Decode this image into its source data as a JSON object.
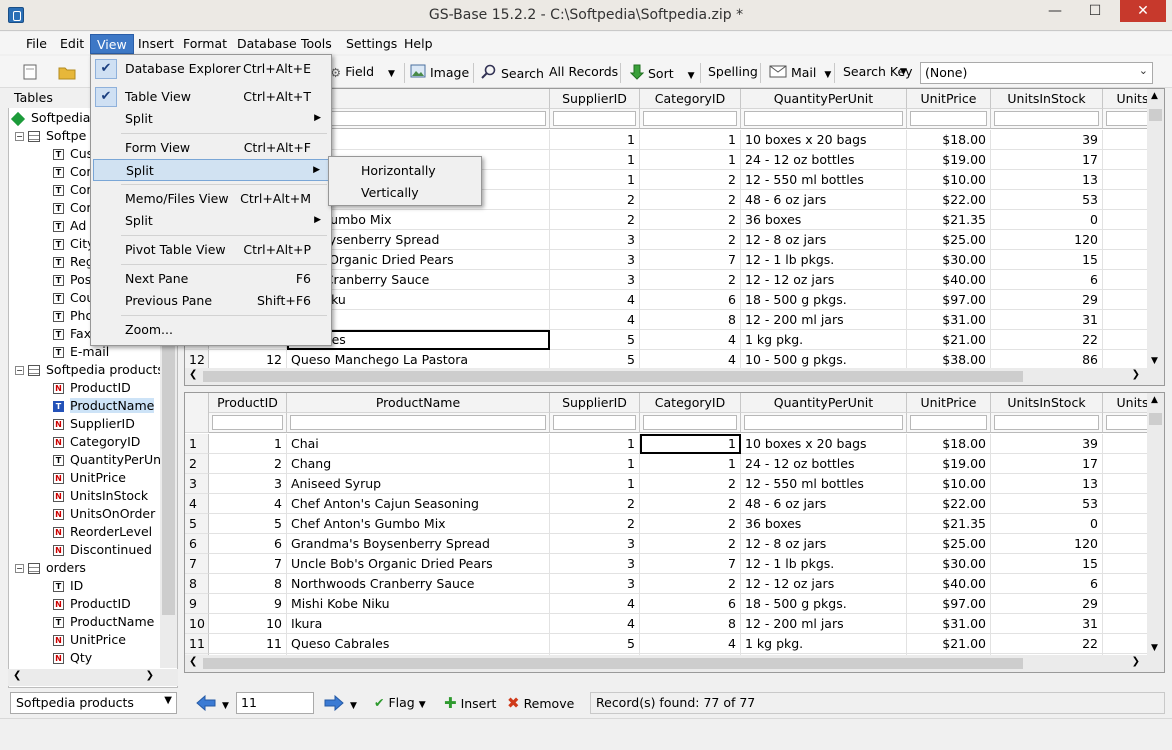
{
  "window": {
    "title": "GS-Base 15.2.2 - C:\\Softpedia\\Softpedia.zip *",
    "minimize": "—",
    "maximize": "☐",
    "close": "✕"
  },
  "menubar": [
    "File",
    "Edit",
    "View",
    "Insert",
    "Format",
    "Database",
    "Tools",
    "Settings",
    "Help"
  ],
  "toolbar": {
    "field": "Field",
    "image": "Image",
    "search": "Search",
    "all_records": "All Records",
    "sort": "Sort",
    "spelling": "Spelling",
    "mail": "Mail",
    "search_key": "Search Key",
    "search_key_value": "(None)"
  },
  "tables_panel": {
    "header": "Tables",
    "tree": [
      {
        "label": "Softpedia",
        "type": "db"
      },
      {
        "label": "Softpe",
        "type": "table"
      },
      {
        "label": "Cus",
        "type": "T"
      },
      {
        "label": "Cor",
        "type": "T"
      },
      {
        "label": "Cor",
        "type": "T"
      },
      {
        "label": "Cor",
        "type": "T"
      },
      {
        "label": "Ad",
        "type": "T"
      },
      {
        "label": "City",
        "type": "T"
      },
      {
        "label": "Reg",
        "type": "T"
      },
      {
        "label": "Pos",
        "type": "T"
      },
      {
        "label": "Cou",
        "type": "T"
      },
      {
        "label": "Pho",
        "type": "T"
      },
      {
        "label": "Fax",
        "type": "T"
      },
      {
        "label": "E-mail",
        "type": "T"
      },
      {
        "label": "Softpedia products",
        "type": "table"
      },
      {
        "label": "ProductID",
        "type": "N"
      },
      {
        "label": "ProductName",
        "type": "T",
        "selected": true
      },
      {
        "label": "SupplierID",
        "type": "N"
      },
      {
        "label": "CategoryID",
        "type": "N"
      },
      {
        "label": "QuantityPerUnit",
        "type": "T"
      },
      {
        "label": "UnitPrice",
        "type": "N"
      },
      {
        "label": "UnitsInStock",
        "type": "N"
      },
      {
        "label": "UnitsOnOrder",
        "type": "N"
      },
      {
        "label": "ReorderLevel",
        "type": "N"
      },
      {
        "label": "Discontinued",
        "type": "N"
      },
      {
        "label": "orders",
        "type": "table"
      },
      {
        "label": "ID",
        "type": "T"
      },
      {
        "label": "ProductID",
        "type": "N"
      },
      {
        "label": "ProductName",
        "type": "T"
      },
      {
        "label": "UnitPrice",
        "type": "N"
      },
      {
        "label": "Qty",
        "type": "N"
      }
    ]
  },
  "view_menu": {
    "items": [
      {
        "label": "Database Explorer",
        "shortcut": "Ctrl+Alt+E",
        "checked": true
      },
      {
        "label": "Table View",
        "shortcut": "Ctrl+Alt+T",
        "checked": true
      },
      {
        "label": "Split",
        "shortcut": "",
        "submenu": true
      },
      {
        "label": "Form View",
        "shortcut": "Ctrl+Alt+F"
      },
      {
        "label": "Split",
        "shortcut": "",
        "submenu": true,
        "highlighted": true
      },
      {
        "label": "Memo/Files View",
        "shortcut": "Ctrl+Alt+M"
      },
      {
        "label": "Split",
        "shortcut": "",
        "submenu": true
      },
      {
        "label": "Pivot Table View",
        "shortcut": "Ctrl+Alt+P"
      },
      {
        "label": "Next Pane",
        "shortcut": "F6"
      },
      {
        "label": "Previous Pane",
        "shortcut": "Shift+F6"
      },
      {
        "label": "Zoom...",
        "shortcut": ""
      }
    ],
    "submenu": [
      "Horizontally",
      "Vertically"
    ]
  },
  "grid": {
    "columns": [
      "ProductID",
      "ProductName",
      "SupplierID",
      "CategoryID",
      "QuantityPerUnit",
      "UnitPrice",
      "UnitsInStock",
      "Units"
    ],
    "rows": [
      [
        "1",
        "1",
        "Chai",
        "1",
        "1",
        "10 boxes x 20 bags",
        "$18.00",
        "39"
      ],
      [
        "2",
        "2",
        "Chang",
        "1",
        "1",
        "24 - 12 oz bottles",
        "$19.00",
        "17"
      ],
      [
        "3",
        "3",
        "Aniseed Syrup",
        "1",
        "2",
        "12 - 550 ml bottles",
        "$10.00",
        "13"
      ],
      [
        "4",
        "4",
        "Chef Anton's Cajun Seasoning",
        "2",
        "2",
        "48 - 6 oz jars",
        "$22.00",
        "53"
      ],
      [
        "5",
        "5",
        "Chef Anton's Gumbo Mix",
        "2",
        "2",
        "36 boxes",
        "$21.35",
        "0"
      ],
      [
        "6",
        "6",
        "Grandma's Boysenberry Spread",
        "3",
        "2",
        "12 - 8 oz jars",
        "$25.00",
        "120"
      ],
      [
        "7",
        "7",
        "Uncle Bob's Organic Dried Pears",
        "3",
        "7",
        "12 - 1 lb pkgs.",
        "$30.00",
        "15"
      ],
      [
        "8",
        "8",
        "Northwoods Cranberry Sauce",
        "3",
        "2",
        "12 - 12 oz jars",
        "$40.00",
        "6"
      ],
      [
        "9",
        "9",
        "Mishi Kobe Niku",
        "4",
        "6",
        "18 - 500 g pkgs.",
        "$97.00",
        "29"
      ],
      [
        "10",
        "10",
        "Ikura",
        "4",
        "8",
        "12 - 200 ml jars",
        "$31.00",
        "31"
      ],
      [
        "11",
        "11",
        "Queso Cabrales",
        "5",
        "4",
        "1 kg pkg.",
        "$21.00",
        "22"
      ],
      [
        "12",
        "12",
        "Queso Manchego La Pastora",
        "5",
        "4",
        "10 - 500 g pkgs.",
        "$38.00",
        "86"
      ]
    ],
    "top_pane_visible_text": [
      "",
      "",
      "",
      "",
      "on's Gumbo Mix",
      "a's Boysenberry Spread",
      "Bob's Organic Dried Pears",
      "oods Cranberry Sauce",
      "obe Niku",
      "",
      "Cabrales",
      "Queso Manchego La Pastora"
    ]
  },
  "bottom": {
    "table_select": "Softpedia products",
    "record": "11",
    "flag": "Flag",
    "insert": "Insert",
    "remove": "Remove",
    "status": "Record(s) found: 77 of 77"
  }
}
